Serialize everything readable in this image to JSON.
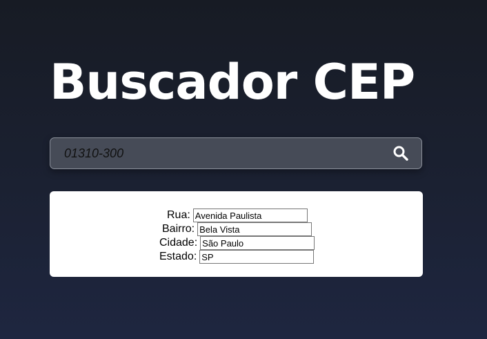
{
  "header": {
    "title": "Buscador CEP"
  },
  "search": {
    "value": "01310-300",
    "icon": "search-icon",
    "icon_color": "#ffffff"
  },
  "result": {
    "fields": [
      {
        "label": "Rua:",
        "value": "Avenida Paulista"
      },
      {
        "label": "Bairro:",
        "value": "Bela Vista"
      },
      {
        "label": "Cidade:",
        "value": "São Paulo"
      },
      {
        "label": "Estado:",
        "value": "SP"
      }
    ]
  },
  "colors": {
    "background": "#1b2132",
    "search_bar": "#464b57",
    "card": "#ffffff",
    "title": "#ffffff"
  }
}
